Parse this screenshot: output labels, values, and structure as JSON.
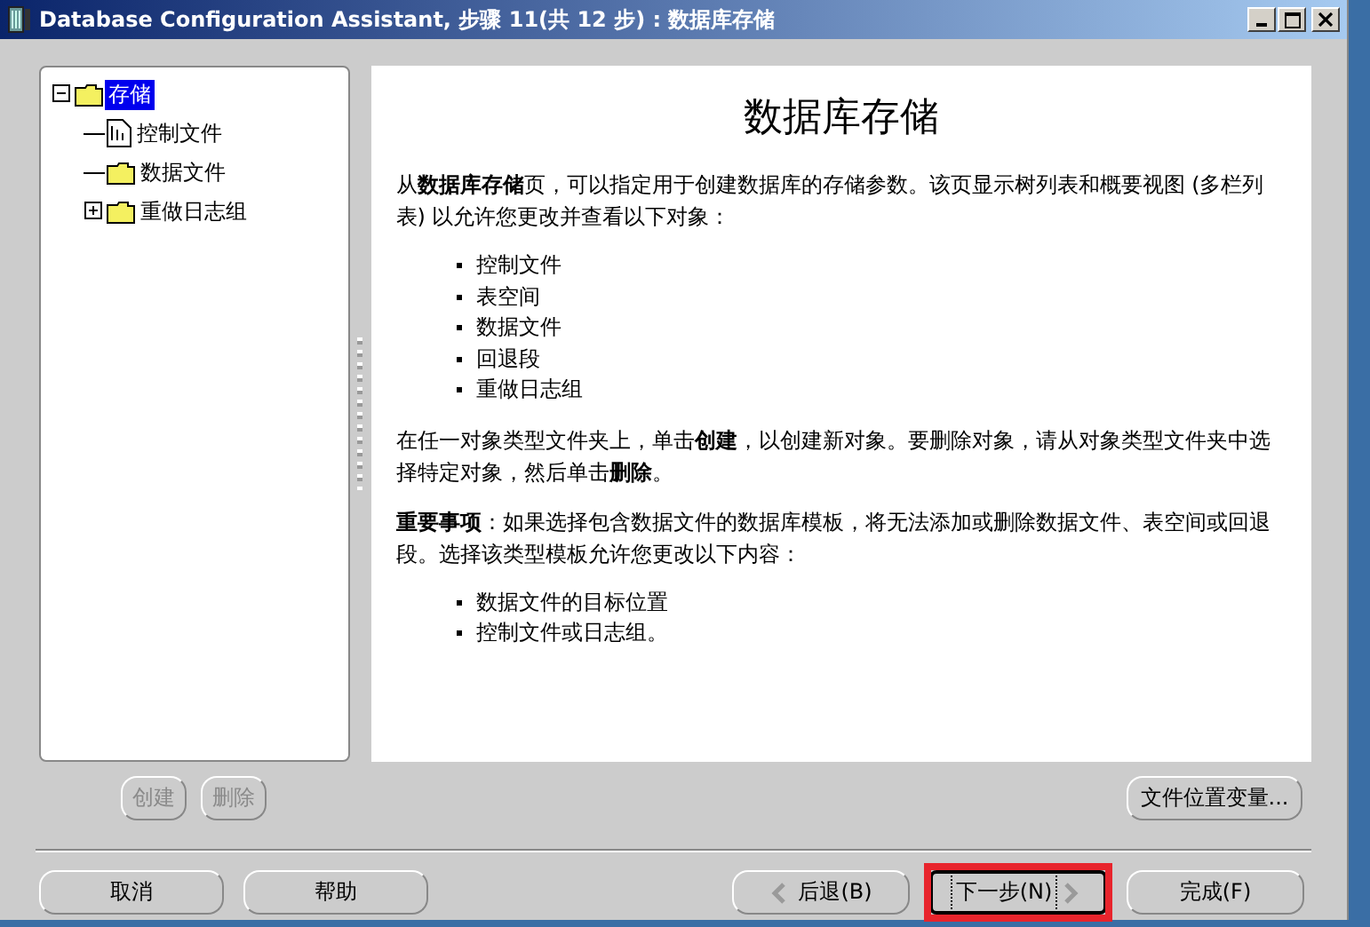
{
  "window": {
    "title": "Database Configuration Assistant, 步骤 11(共 12 步) : 数据库存储"
  },
  "tree": [
    {
      "label": "存储",
      "kind": "folder",
      "selected": true,
      "expanded": true,
      "children": [
        {
          "label": "控制文件",
          "kind": "file",
          "selected": false
        },
        {
          "label": "数据文件",
          "kind": "folder",
          "selected": false
        },
        {
          "label": "重做日志组",
          "kind": "folder",
          "selected": false,
          "expanded": false
        }
      ]
    }
  ],
  "content": {
    "heading": "数据库存储",
    "blocks": [
      {
        "kind": "paragraph",
        "text": "从**数据库存储**页，可以指定用于创建数据库的存储参数。该页显示树列表和概要视图 (多栏列表) 以允许您更改并查看以下对象："
      },
      {
        "kind": "list",
        "items": [
          "控制文件",
          "表空间",
          "数据文件",
          "回退段",
          "重做日志组"
        ]
      },
      {
        "kind": "paragraph",
        "text": "在任一对象类型文件夹上，单击**创建**，以创建新对象。要删除对象，请从对象类型文件夹中选择特定对象，然后单击**删除**。"
      },
      {
        "kind": "paragraph",
        "text": "**重要事项**：如果选择包含数据文件的数据库模板，将无法添加或删除数据文件、表空间或回退段。选择该类型模板允许您更改以下内容："
      },
      {
        "kind": "list",
        "items": [
          "数据文件的目标位置",
          "控制文件或日志组。"
        ]
      }
    ]
  },
  "tree_buttons": [
    {
      "label": "创建",
      "disabled": true
    },
    {
      "label": "删除",
      "disabled": true
    }
  ],
  "file_location_button": {
    "label": "文件位置变量...",
    "disabled": false
  },
  "footer_left": [
    {
      "label": "取消",
      "disabled": false
    },
    {
      "label": "帮助",
      "disabled": false
    }
  ],
  "footer_right": [
    {
      "label": "后退(B)",
      "kind": "back",
      "disabled": false,
      "focused": false,
      "highlighted": false
    },
    {
      "label": "下一步(N)",
      "kind": "next",
      "disabled": false,
      "focused": true,
      "highlighted": true
    },
    {
      "label": "完成(F)",
      "disabled": false,
      "focused": false,
      "highlighted": false
    }
  ]
}
